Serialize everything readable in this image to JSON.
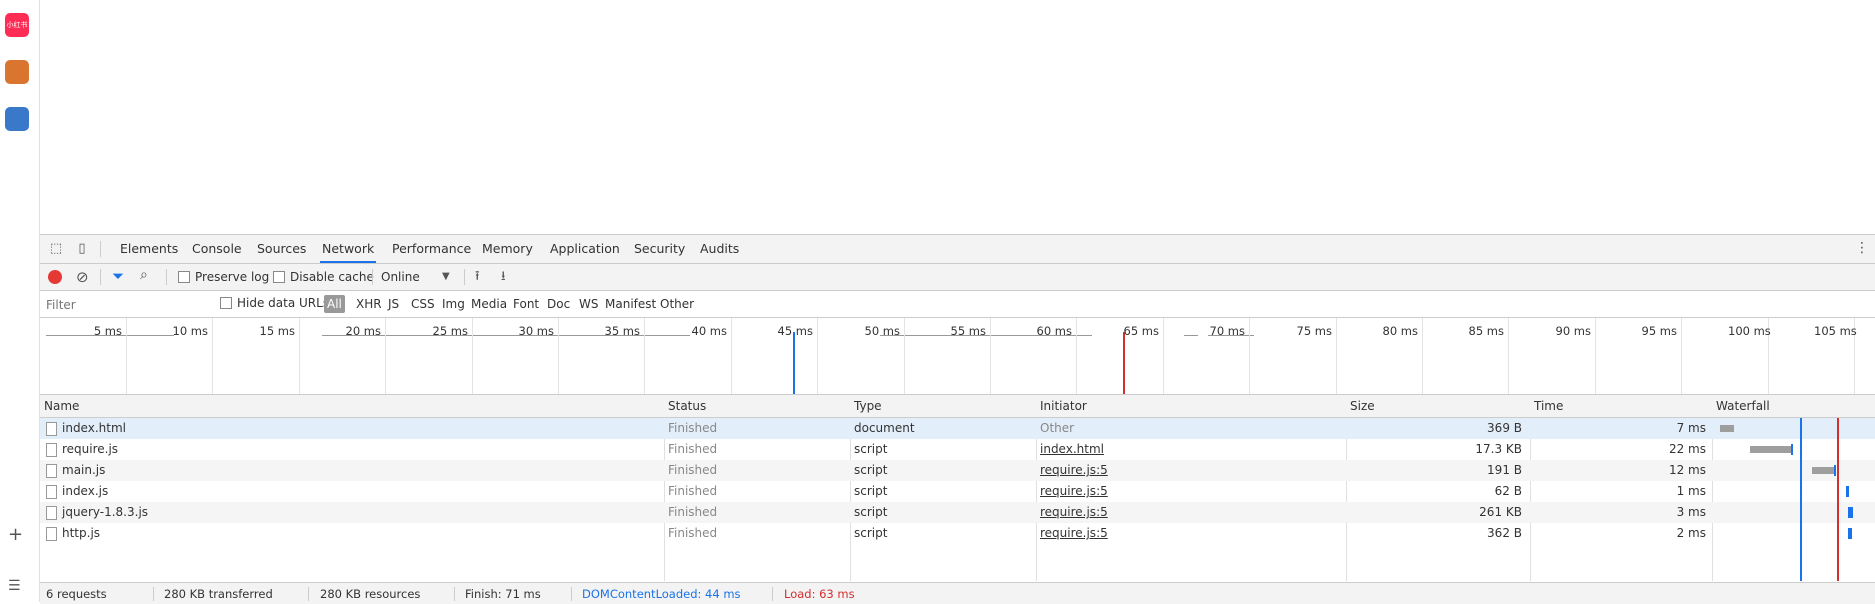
{
  "side_apps": [
    {
      "name": "app-1",
      "label": "小红书"
    },
    {
      "name": "app-2",
      "label": ""
    },
    {
      "name": "app-3",
      "label": ""
    }
  ],
  "devtools": {
    "tabs": [
      "Elements",
      "Console",
      "Sources",
      "Network",
      "Performance",
      "Memory",
      "Application",
      "Security",
      "Audits"
    ],
    "active_tab": "Network"
  },
  "toolbar": {
    "preserve_log": "Preserve log",
    "disable_cache": "Disable cache",
    "throttling": "Online"
  },
  "filterbar": {
    "placeholder": "Filter",
    "hide_data_urls": "Hide data URLs",
    "types": [
      "All",
      "XHR",
      "JS",
      "CSS",
      "Img",
      "Media",
      "Font",
      "Doc",
      "WS",
      "Manifest",
      "Other"
    ],
    "active_type": "All"
  },
  "overview": {
    "ticks": [
      "5 ms",
      "10 ms",
      "15 ms",
      "20 ms",
      "25 ms",
      "30 ms",
      "35 ms",
      "40 ms",
      "45 ms",
      "50 ms",
      "55 ms",
      "60 ms",
      "65 ms",
      "70 ms",
      "75 ms",
      "80 ms",
      "85 ms",
      "90 ms",
      "95 ms",
      "100 ms",
      "105 ms"
    ]
  },
  "table": {
    "columns": [
      "Name",
      "Status",
      "Type",
      "Initiator",
      "Size",
      "Time",
      "Waterfall"
    ],
    "rows": [
      {
        "name": "index.html",
        "status": "Finished",
        "type": "document",
        "initiator": "Other",
        "size": "369 B",
        "time": "7 ms"
      },
      {
        "name": "require.js",
        "status": "Finished",
        "type": "script",
        "initiator": "index.html",
        "size": "17.3 KB",
        "time": "22 ms"
      },
      {
        "name": "main.js",
        "status": "Finished",
        "type": "script",
        "initiator": "require.js:5",
        "size": "191 B",
        "time": "12 ms"
      },
      {
        "name": "index.js",
        "status": "Finished",
        "type": "script",
        "initiator": "require.js:5",
        "size": "62 B",
        "time": "1 ms"
      },
      {
        "name": "jquery-1.8.3.js",
        "status": "Finished",
        "type": "script",
        "initiator": "require.js:5",
        "size": "261 KB",
        "time": "3 ms"
      },
      {
        "name": "http.js",
        "status": "Finished",
        "type": "script",
        "initiator": "require.js:5",
        "size": "362 B",
        "time": "2 ms"
      }
    ]
  },
  "statusbar": {
    "requests": "6 requests",
    "transferred": "280 KB transferred",
    "resources": "280 KB resources",
    "finish": "Finish: 71 ms",
    "dcl": "DOMContentLoaded: 44 ms",
    "load": "Load: 63 ms"
  },
  "colors": {
    "accent": "#1a73e8",
    "record": "#e53935",
    "load_marker": "#d32f2f",
    "dcl_marker": "#1a73e8"
  }
}
